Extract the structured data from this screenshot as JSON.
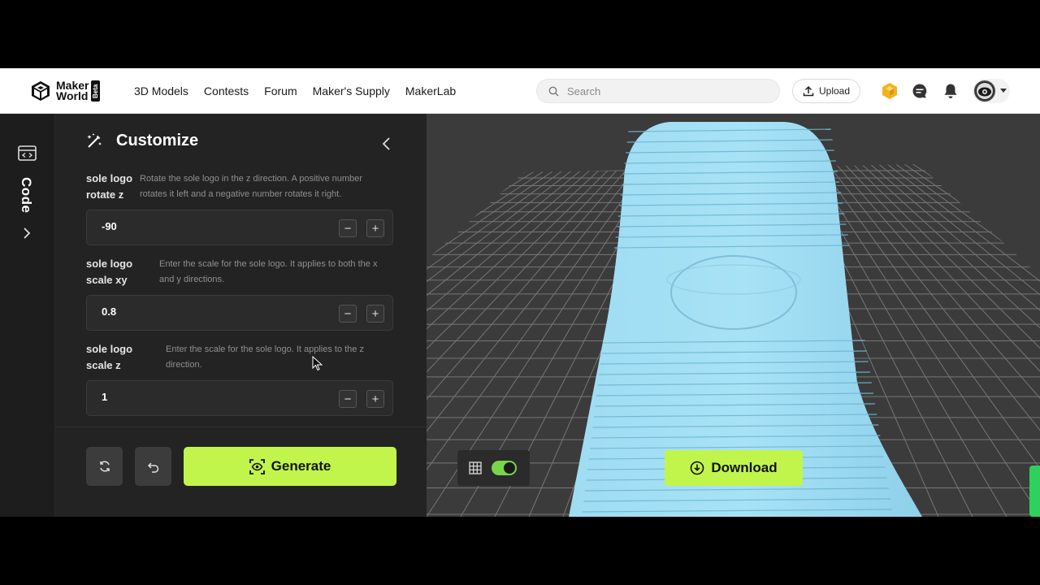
{
  "brand": {
    "line1": "Maker",
    "line2": "World",
    "badge": "Beta"
  },
  "nav": {
    "links": [
      "3D Models",
      "Contests",
      "Forum",
      "Maker's Supply",
      "MakerLab"
    ]
  },
  "search": {
    "placeholder": "Search"
  },
  "upload": {
    "label": "Upload"
  },
  "rail": {
    "label": "Code"
  },
  "panel": {
    "title": "Customize"
  },
  "params": [
    {
      "name": "sole logo rotate z",
      "description": "Rotate the sole logo in the z direction. A positive number rotates it left and a negative number rotates it right.",
      "value": "-90"
    },
    {
      "name": "sole logo scale xy",
      "description": "Enter the scale for the sole logo. It applies to both the x and y directions.",
      "value": "0.8"
    },
    {
      "name": "sole logo scale z",
      "description": "Enter the scale for the sole logo. It applies to the z direction.",
      "value": "1"
    }
  ],
  "actions": {
    "generate": "Generate",
    "download": "Download"
  },
  "colors": {
    "accent": "#c1f54c",
    "model": "#8fd3ee",
    "toggle": "#79d64a"
  }
}
